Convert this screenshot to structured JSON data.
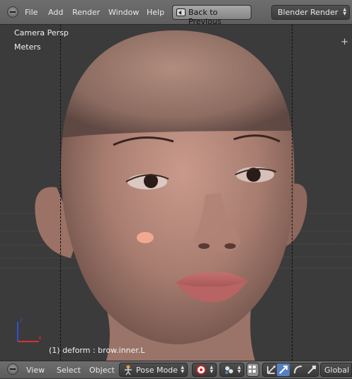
{
  "top_header": {
    "menu": [
      "File",
      "Add",
      "Render",
      "Window",
      "Help"
    ],
    "back_button": "Back to Previous",
    "render_engine": "Blender Render"
  },
  "viewport": {
    "view_label": "Camera Persp",
    "units_label": "Meters",
    "status": "(1) deform : brow.inner.L",
    "axis_x": "x",
    "axis_z": "z"
  },
  "bottom_header": {
    "menu": [
      "View",
      "Select",
      "Object"
    ],
    "mode": "Pose Mode",
    "orientation": "Global"
  },
  "colors": {
    "header": "#666666",
    "viewport_bg": "#3b3b3b",
    "manipulator_active": "#5680c2"
  }
}
